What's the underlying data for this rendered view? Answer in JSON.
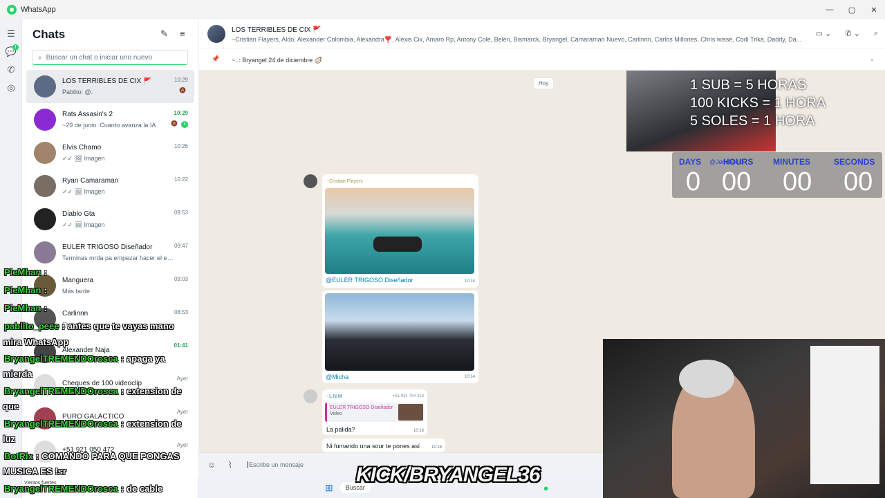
{
  "app": {
    "title": "WhatsApp"
  },
  "window": {
    "minimize": "—",
    "maximize": "▢",
    "close": "✕"
  },
  "rail": {
    "badge": "1"
  },
  "chatlist": {
    "title": "Chats",
    "search_placeholder": "Buscar un chat o iniciar uno nuevo",
    "items": [
      {
        "name": "LOS TERRIBLES DE CIX 🚩",
        "preview": "Pablito: @.",
        "time": "10:29",
        "color": "#5b6b86"
      },
      {
        "name": "Rats Assasin's 2",
        "preview": "~29 de junio: Cuanto avanza la IA",
        "time": "10:29",
        "badge": "1",
        "color": "#8a2bd1"
      },
      {
        "name": "Elvis Chamo",
        "preview": "✓✓ 🖼 Imagen",
        "time": "10:26",
        "color": "#a0836b"
      },
      {
        "name": "Ryan Camaraman",
        "preview": "✓✓ 🖼 Imagen",
        "time": "10:22",
        "color": "#7a6e64"
      },
      {
        "name": "Diablo Gta",
        "preview": "✓✓ 🖼 Imagen",
        "time": "09:53",
        "color": "#222222"
      },
      {
        "name": "EULER TRIGOSO Diseñador",
        "preview": "Terminas mrda pa empezar hacer el em...",
        "time": "09:47",
        "color": "#8a7a96"
      },
      {
        "name": "Manguera",
        "preview": "Más tarde",
        "time": "09:03",
        "color": "#6b5a3a"
      },
      {
        "name": "Carlinnn",
        "preview": "Que chus",
        "time": "08:53",
        "color": "#555555"
      },
      {
        "name": "Alexander Ñaja",
        "preview": "",
        "time": "01:41",
        "color": "#444444"
      },
      {
        "name": "Cheques de 100 videoclip",
        "preview": "",
        "time": "Ayer",
        "color": "#dddddd"
      },
      {
        "name": "PURO GALÁCTICO",
        "preview": "",
        "time": "Ayer",
        "color": "#a04050"
      },
      {
        "name": "+51 921 050 472",
        "preview": "",
        "time": "Ayer",
        "color": "#dddddd"
      }
    ],
    "bottom_label": "Vientos fuertes"
  },
  "header": {
    "group_name": "LOS TERRIBLES DE CIX 🚩",
    "members": "~Cristian Flayers, Aldo, Alexander Colombia, Alexandra❣️, Alexis Cix, Amaro Rp, Antony Cole, Belén, Bismarck, Bryangel, Camaraman Nuevo, Carlinnn, Carlos Millones, Chris wisse, Codi Trika, Daddy, Da..."
  },
  "pinned": {
    "text": "~..: Bryangel 24 de diciembre 🦪"
  },
  "chat": {
    "day": "Hoy",
    "messages": [
      {
        "sender": "~Cristian Flayers",
        "mention": "@EULER TRIGOSO Diseñador",
        "time": "10:14",
        "image": "jetski"
      },
      {
        "mention": "@Micha",
        "time": "10:14",
        "image": "cockpit"
      },
      {
        "sender": "~L.N.M",
        "phone": "+51 934 794 328",
        "quote_author": "EULER TRIGOSO Diseñador",
        "quote_type": "Video",
        "text": "La palida?",
        "time": "10:16"
      },
      {
        "text": "Ni fumando una sour te pones así",
        "time": "10:16"
      }
    ]
  },
  "composer": {
    "placeholder": "Escribe un mensaje"
  },
  "taskbar": {
    "search": "Buscar"
  },
  "stream_overlay": {
    "goals": [
      "1 SUB = 5 HORAS",
      "100 KICKS = 1 HORA",
      "5 SOLES = 1 HORA"
    ],
    "timer_labels": [
      "DAYS",
      "HOURS",
      "MINUTES",
      "SECONDS"
    ],
    "timer_values": [
      "0",
      "00",
      "00",
      "00"
    ],
    "timer_tag": "@Jericho10",
    "banner": "KICK/BRYANGEL36",
    "chat": [
      {
        "user": "PieMhan",
        "sep": ":",
        "msg": ""
      },
      {
        "user": "PieMhan",
        "sep": ":",
        "msg": ""
      },
      {
        "user": "PieMhan",
        "sep": ":",
        "msg": ""
      },
      {
        "user": "pablito_peee",
        "sep": ":",
        "msg": "antes que te vayas mano"
      },
      {
        "user": "",
        "sep": "",
        "msg": "mira WhatsApp"
      },
      {
        "user": "BryangelTREMENDOrosca",
        "sep": ":",
        "msg": "apaga ya"
      },
      {
        "user": "",
        "sep": "",
        "msg": "mierda"
      },
      {
        "user": "BryangelTREMENDOrosca",
        "sep": ":",
        "msg": "extension de"
      },
      {
        "user": "",
        "sep": "",
        "msg": "que"
      },
      {
        "user": "BryangelTREMENDOrosca",
        "sep": ":",
        "msg": "extension de"
      },
      {
        "user": "",
        "sep": "",
        "msg": "luz"
      },
      {
        "user": "BotRix",
        "sep": ":",
        "msg": "COMANDO PARA QUE PONGAS"
      },
      {
        "user": "",
        "sep": "",
        "msg": "MUSICA ES !sr"
      },
      {
        "user": "BryangelTREMENDOrosca",
        "sep": ":",
        "msg": "de cable"
      }
    ]
  }
}
